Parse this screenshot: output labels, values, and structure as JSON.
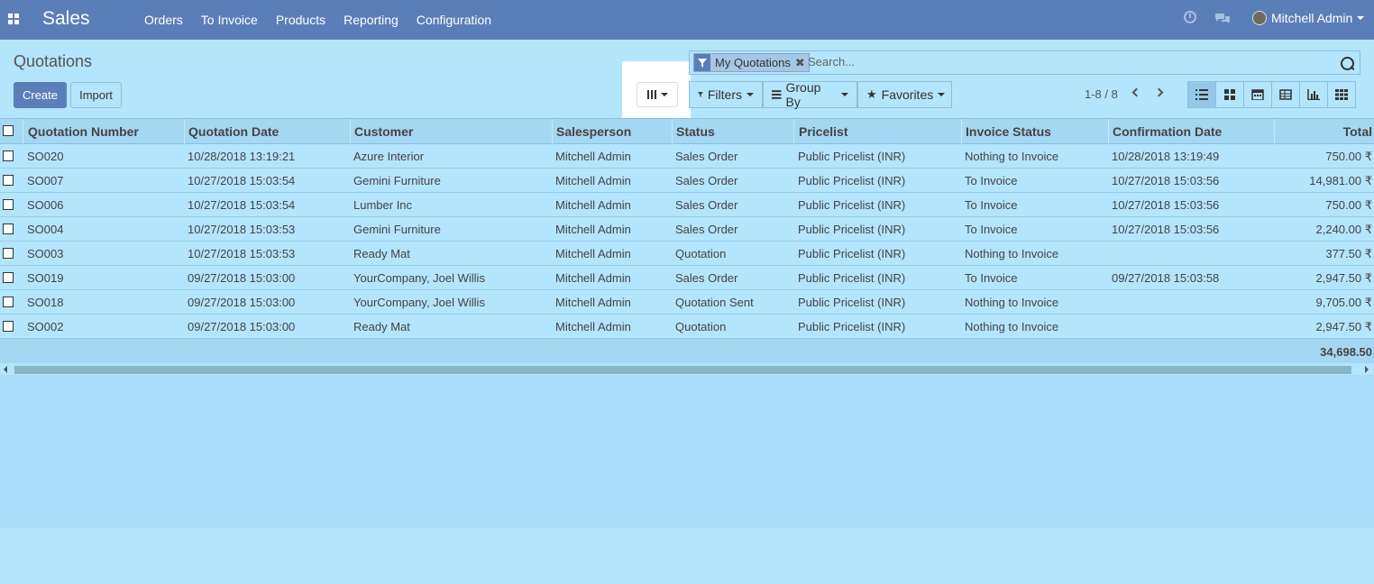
{
  "navbar": {
    "app_name": "Sales",
    "menu": [
      "Orders",
      "To Invoice",
      "Products",
      "Reporting",
      "Configuration"
    ],
    "user_name": "Mitchell Admin"
  },
  "control_panel": {
    "title": "Quotations",
    "create_label": "Create",
    "import_label": "Import",
    "search": {
      "facet_label": "My Quotations",
      "facet_remove": "✖",
      "placeholder": "Search..."
    },
    "filters_label": "Filters",
    "group_by_label": "Group By",
    "favorites_label": "Favorites",
    "pager": "1-8 / 8",
    "views": [
      "list-view-icon",
      "kanban-view-icon",
      "calendar-view-icon",
      "pivot-view-icon",
      "graph-view-icon",
      "grid-view-icon"
    ]
  },
  "table": {
    "columns": [
      "Quotation Number",
      "Quotation Date",
      "Customer",
      "Salesperson",
      "Status",
      "Pricelist",
      "Invoice Status",
      "Confirmation Date",
      "Total"
    ],
    "rows": [
      [
        "SO020",
        "10/28/2018 13:19:21",
        "Azure Interior",
        "Mitchell Admin",
        "Sales Order",
        "Public Pricelist (INR)",
        "Nothing to Invoice",
        "10/28/2018 13:19:49",
        "750.00 ₹"
      ],
      [
        "SO007",
        "10/27/2018 15:03:54",
        "Gemini Furniture",
        "Mitchell Admin",
        "Sales Order",
        "Public Pricelist (INR)",
        "To Invoice",
        "10/27/2018 15:03:56",
        "14,981.00 ₹"
      ],
      [
        "SO006",
        "10/27/2018 15:03:54",
        "Lumber Inc",
        "Mitchell Admin",
        "Sales Order",
        "Public Pricelist (INR)",
        "To Invoice",
        "10/27/2018 15:03:56",
        "750.00 ₹"
      ],
      [
        "SO004",
        "10/27/2018 15:03:53",
        "Gemini Furniture",
        "Mitchell Admin",
        "Sales Order",
        "Public Pricelist (INR)",
        "To Invoice",
        "10/27/2018 15:03:56",
        "2,240.00 ₹"
      ],
      [
        "SO003",
        "10/27/2018 15:03:53",
        "Ready Mat",
        "Mitchell Admin",
        "Quotation",
        "Public Pricelist (INR)",
        "Nothing to Invoice",
        "",
        "377.50 ₹"
      ],
      [
        "SO019",
        "09/27/2018 15:03:00",
        "YourCompany, Joel Willis",
        "Mitchell Admin",
        "Sales Order",
        "Public Pricelist (INR)",
        "To Invoice",
        "09/27/2018 15:03:58",
        "2,947.50 ₹"
      ],
      [
        "SO018",
        "09/27/2018 15:03:00",
        "YourCompany, Joel Willis",
        "Mitchell Admin",
        "Quotation Sent",
        "Public Pricelist (INR)",
        "Nothing to Invoice",
        "",
        "9,705.00 ₹"
      ],
      [
        "SO002",
        "09/27/2018 15:03:00",
        "Ready Mat",
        "Mitchell Admin",
        "Quotation",
        "Public Pricelist (INR)",
        "Nothing to Invoice",
        "",
        "2,947.50 ₹"
      ]
    ],
    "total": "34,698.50"
  }
}
